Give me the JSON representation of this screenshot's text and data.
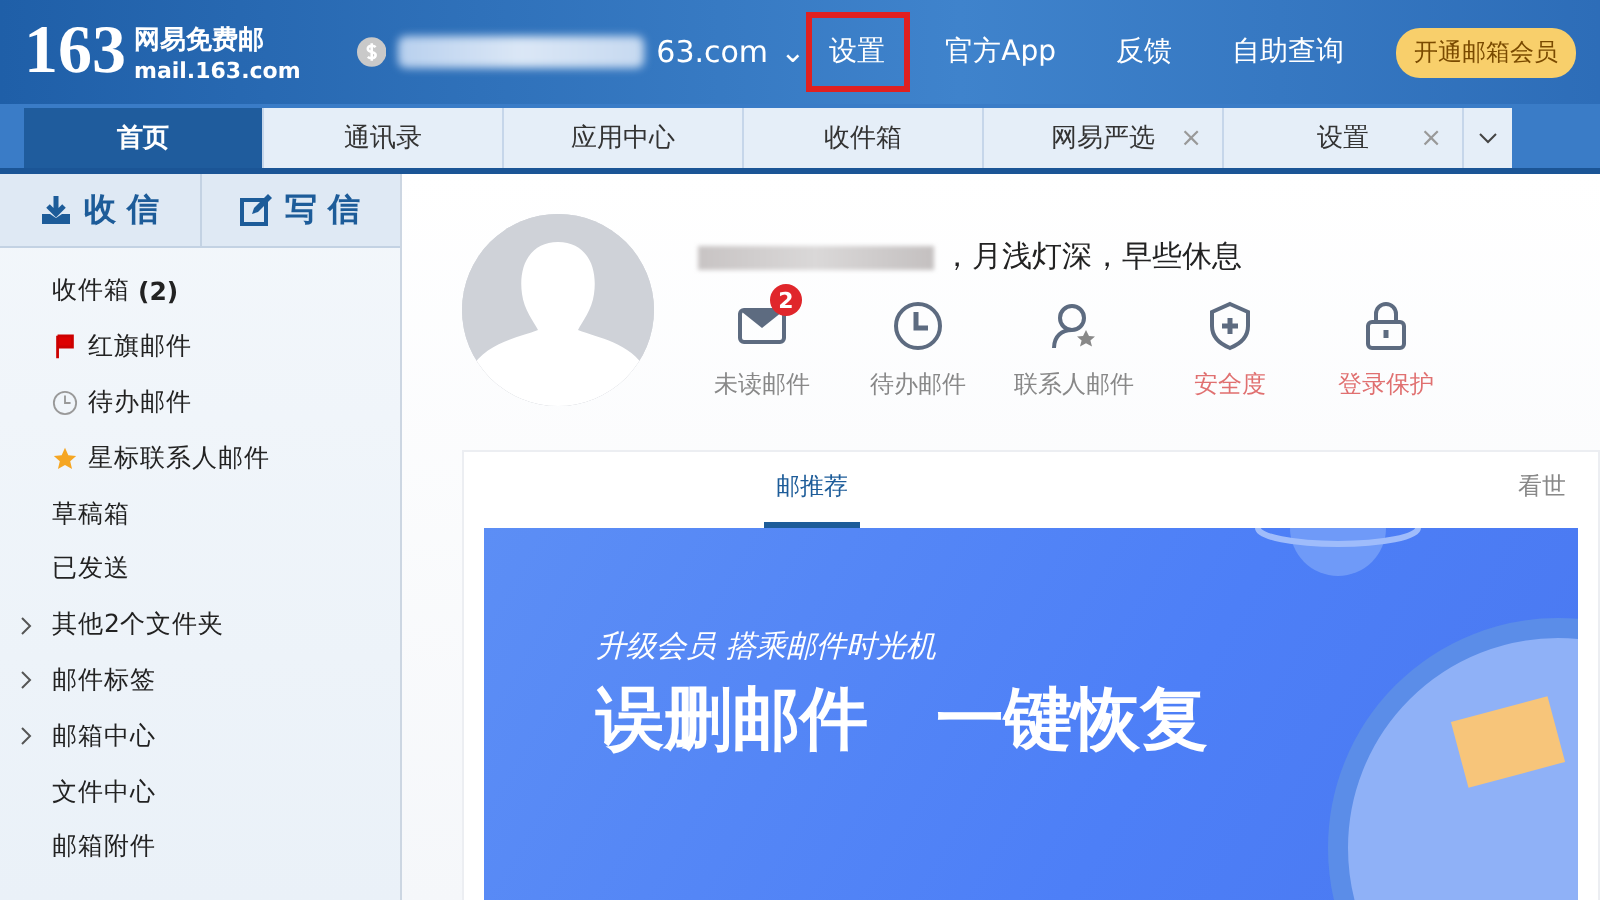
{
  "logo": {
    "number": "163",
    "name": "网易免费邮",
    "domain": "mail.163.com"
  },
  "account": {
    "email_visible": "63.com",
    "caret": "⌄"
  },
  "nav": [
    {
      "label": "设置",
      "highlighted": true
    },
    {
      "label": "官方App",
      "highlighted": false
    },
    {
      "label": "反馈",
      "highlighted": false
    },
    {
      "label": "自助查询",
      "highlighted": false
    }
  ],
  "vip_button": "开通邮箱会员",
  "tabs": [
    {
      "label": "首页",
      "selected": true,
      "closable": false
    },
    {
      "label": "通讯录",
      "selected": false,
      "closable": false
    },
    {
      "label": "应用中心",
      "selected": false,
      "closable": false
    },
    {
      "label": "收件箱",
      "selected": false,
      "closable": false
    },
    {
      "label": "网易严选",
      "selected": false,
      "closable": true
    },
    {
      "label": "设置",
      "selected": false,
      "closable": true
    }
  ],
  "tab_close": "×",
  "sidebar": {
    "receive": "收 信",
    "compose": "写 信",
    "items": [
      {
        "kind": "plain",
        "label": "收件箱",
        "count": "(2)",
        "expandable": false
      },
      {
        "kind": "flag",
        "label": "红旗邮件",
        "expandable": false
      },
      {
        "kind": "clock",
        "label": "待办邮件",
        "expandable": false
      },
      {
        "kind": "star",
        "label": "星标联系人邮件",
        "expandable": false
      },
      {
        "kind": "plain",
        "label": "草稿箱",
        "expandable": false
      },
      {
        "kind": "plain",
        "label": "已发送",
        "expandable": false
      },
      {
        "kind": "plain",
        "label": "其他2个文件夹",
        "expandable": true
      },
      {
        "kind": "plain",
        "label": "邮件标签",
        "expandable": true
      },
      {
        "kind": "plain",
        "label": "邮箱中心",
        "expandable": true
      },
      {
        "kind": "plain",
        "label": "文件中心",
        "expandable": false
      },
      {
        "kind": "plain",
        "label": "邮箱附件",
        "expandable": false
      }
    ]
  },
  "greeting": "，月浅灯深，早些休息",
  "shortcuts": [
    {
      "kind": "mail",
      "label": "未读邮件",
      "badge": "2",
      "warning": false
    },
    {
      "kind": "clock",
      "label": "待办邮件",
      "warning": false
    },
    {
      "kind": "contact",
      "label": "联系人邮件",
      "warning": false
    },
    {
      "kind": "shield",
      "label": "安全度",
      "warning": true
    },
    {
      "kind": "lock",
      "label": "登录保护",
      "warning": true
    }
  ],
  "feed_tabs": [
    {
      "label": "邮推荐",
      "selected": true
    },
    {
      "label": "看世",
      "selected": false
    }
  ],
  "banner": {
    "tagline": "升级会员 搭乘邮件时光机",
    "headline": "误删邮件　一键恢复"
  }
}
